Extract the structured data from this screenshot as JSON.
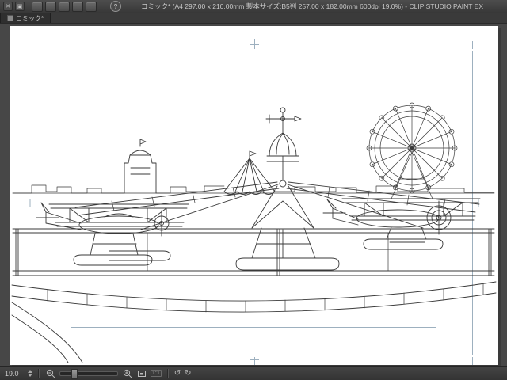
{
  "titlebar": {
    "title": "コミック* (A4 297.00 x 210.00mm 製本サイズ:B5判 257.00 x 182.00mm 600dpi 19.0%) - CLIP STUDIO PAINT EX",
    "help_label": "?",
    "window_icons": [
      "close-icon",
      "panel-toggle-icon"
    ],
    "toolbar_icons": [
      "new-icon",
      "open-icon",
      "save-icon",
      "undo-icon",
      "redo-icon"
    ]
  },
  "tab": {
    "label": "コミック*"
  },
  "statusbar": {
    "zoom_value": "19.0",
    "icons": [
      "zoom-out-icon",
      "zoom-slider",
      "zoom-in-icon",
      "fit-to-window-icon",
      "actual-size-label",
      "rotate-left-icon",
      "rotate-right-icon"
    ],
    "actual_size_label": "1:1"
  },
  "canvas": {
    "description": "Line-art illustration: fairground aeroplane carousel with two seaplane gondolas, central onion-dome pylon with weather vane, circus tent, clock tower, city skyline and Ferris wheel behind a curved railing platform",
    "page_format": "A4 spread with bleed and trim print guides"
  },
  "colors": {
    "chrome": "#3c3c3c",
    "canvas_bg": "#474747",
    "paper": "#ffffff",
    "guide": "#9db0bf",
    "ink": "#3a3a3a"
  }
}
